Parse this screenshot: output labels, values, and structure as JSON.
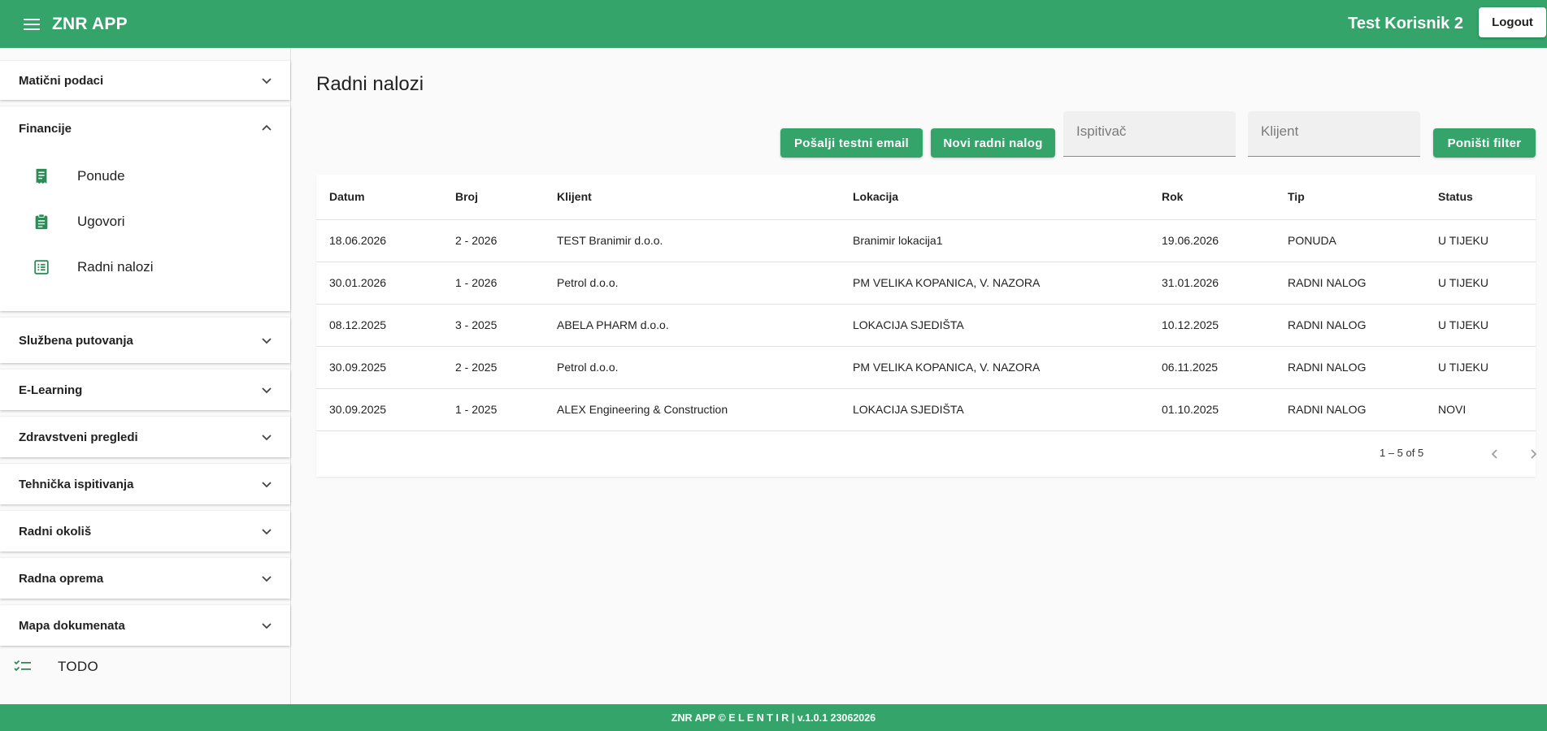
{
  "header": {
    "app_title": "ZNR APP",
    "user_name": "Test Korisnik 2",
    "logout_label": "Logout"
  },
  "sidebar": {
    "sections": [
      {
        "label": "Matični podaci",
        "expanded": false
      },
      {
        "label": "Financije",
        "expanded": true
      },
      {
        "label": "Službena putovanja",
        "expanded": false
      },
      {
        "label": "E-Learning",
        "expanded": false
      },
      {
        "label": "Zdravstveni pregledi",
        "expanded": false
      },
      {
        "label": "Tehnička ispitivanja",
        "expanded": false
      },
      {
        "label": "Radni okoliš",
        "expanded": false
      },
      {
        "label": "Radna oprema",
        "expanded": false
      },
      {
        "label": "Mapa dokumenata",
        "expanded": false
      }
    ],
    "financije_items": [
      {
        "label": "Ponude",
        "icon": "receipt-icon"
      },
      {
        "label": "Ugovori",
        "icon": "clipboard-icon"
      },
      {
        "label": "Radni nalozi",
        "icon": "list-alt-icon"
      }
    ],
    "todo_label": "TODO"
  },
  "main": {
    "title": "Radni nalozi",
    "send_test_email_label": "Pošalji testni email",
    "new_order_label": "Novi radni nalog",
    "filter_ispitivac_placeholder": "Ispitivač",
    "filter_klijent_placeholder": "Klijent",
    "reset_filter_label": "Poništi filter"
  },
  "table": {
    "columns": [
      "Datum",
      "Broj",
      "Klijent",
      "Lokacija",
      "Rok",
      "Tip",
      "Status"
    ],
    "rows": [
      [
        "18.06.2026",
        "2 - 2026",
        "TEST Branimir d.o.o.",
        "Branimir lokacija1",
        "19.06.2026",
        "PONUDA",
        "U TIJEKU"
      ],
      [
        "30.01.2026",
        "1 - 2026",
        "Petrol d.o.o.",
        "PM VELIKA KOPANICA, V. NAZORA",
        "31.01.2026",
        "RADNI NALOG",
        "U TIJEKU"
      ],
      [
        "08.12.2025",
        "3 - 2025",
        "ABELA PHARM d.o.o.",
        "LOKACIJA SJEDIŠTA",
        "10.12.2025",
        "RADNI NALOG",
        "U TIJEKU"
      ],
      [
        "30.09.2025",
        "2 - 2025",
        "Petrol d.o.o.",
        "PM VELIKA KOPANICA, V. NAZORA",
        "06.11.2025",
        "RADNI NALOG",
        "U TIJEKU"
      ],
      [
        "30.09.2025",
        "1 - 2025",
        "ALEX Engineering & Construction",
        "LOKACIJA SJEDIŠTA",
        "01.10.2025",
        "RADNI NALOG",
        "NOVI"
      ]
    ],
    "range_label": "1 – 5 of 5"
  },
  "footer": {
    "text": "ZNR APP © E L E N T I R | v.1.0.1 23062026"
  },
  "colors": {
    "primary": "#34a46b",
    "icon_green": "#2e8b57"
  }
}
